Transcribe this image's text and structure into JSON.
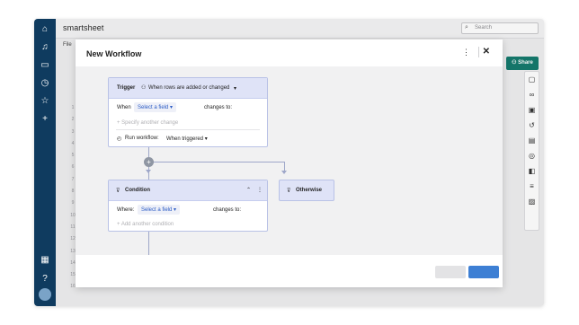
{
  "app": {
    "brand": "smartsheet",
    "search_placeholder": "Search",
    "file_menu": "File",
    "share_label": "Share",
    "row_numbers": [
      "1",
      "2",
      "3",
      "4",
      "5",
      "6",
      "7",
      "8",
      "9",
      "10",
      "11",
      "12",
      "13",
      "14",
      "15",
      "16"
    ]
  },
  "left_nav": {
    "icons": [
      "home-icon",
      "bell-icon",
      "folder-icon",
      "clock-icon",
      "star-icon",
      "plus-icon",
      "apps-grid-icon",
      "help-icon",
      "avatar"
    ]
  },
  "right_panel": {
    "icons": [
      "comment-icon",
      "link-icon",
      "briefcase-icon",
      "history-icon",
      "attachment-icon",
      "proofing-icon",
      "layout-icon",
      "activity-icon",
      "summary-icon"
    ]
  },
  "modal": {
    "title": "New Workflow",
    "trigger": {
      "label": "Trigger",
      "event": "When rows are added or changed",
      "when_label": "When",
      "field_select": "Select a field",
      "changes_to": "changes to:",
      "specify_another": "+ Specify another change",
      "run_label": "Run workflow:",
      "run_value": "When triggered"
    },
    "condition": {
      "label": "Condition",
      "where_label": "Where:",
      "field_select": "Select a field",
      "changes_to": "changes to:",
      "add_another": "+ Add another condition"
    },
    "otherwise": {
      "label": "Otherwise"
    },
    "plus_symbol": "+",
    "close_symbol": "✕",
    "kebab_symbol": "⋮"
  }
}
